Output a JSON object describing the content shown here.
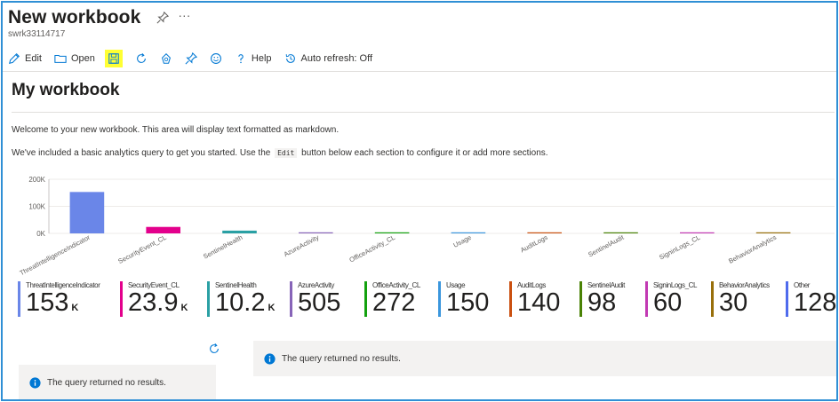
{
  "header": {
    "title": "New workbook",
    "more_label": "···",
    "subtitle": "swrk33114717"
  },
  "toolbar": {
    "edit_label": "Edit",
    "open_label": "Open",
    "help_label": "Help",
    "auto_refresh_label": "Auto refresh: Off"
  },
  "workbook": {
    "heading": "My workbook",
    "para1": "Welcome to your new workbook. This area will display text formatted as markdown.",
    "para2_before": "We've included a basic analytics query to get you started. Use the",
    "para2_code": "Edit",
    "para2_after": "button below each section to configure it or add more sections."
  },
  "colors": {
    "accent": "#2f8fd5",
    "highlight": "#ffff33",
    "info_icon": "#0078d4"
  },
  "chart_data": {
    "type": "bar",
    "ylim": [
      0,
      200000
    ],
    "yticks": [
      "200K",
      "100K",
      "0K"
    ],
    "ytick_values": [
      200000,
      100000,
      0
    ],
    "categories": [
      "ThreatIntelligenceIndicator",
      "SecurityEvent_CL",
      "SentinelHealth",
      "AzureActivity",
      "OfficeActivity_CL",
      "Usage",
      "AuditLogs",
      "SentinelAudit",
      "SigninLogs_CL",
      "BehaviorAnalytics"
    ],
    "values": [
      153000,
      23900,
      10200,
      505,
      272,
      150,
      140,
      98,
      60,
      30
    ],
    "colors": [
      "#6a86e8",
      "#e3008c",
      "#2aa0a4",
      "#8764b8",
      "#13a10e",
      "#3a96dd",
      "#ca5010",
      "#498205",
      "#c239b3",
      "#986f0b"
    ]
  },
  "tiles": [
    {
      "label": "ThreatIntelligenceIndicator",
      "value": "153",
      "unit": "K",
      "color": "#6a86e8"
    },
    {
      "label": "SecurityEvent_CL",
      "value": "23.9",
      "unit": "K",
      "color": "#e3008c"
    },
    {
      "label": "SentinelHealth",
      "value": "10.2",
      "unit": "K",
      "color": "#2aa0a4"
    },
    {
      "label": "AzureActivity",
      "value": "505",
      "unit": "",
      "color": "#8764b8"
    },
    {
      "label": "OfficeActivity_CL",
      "value": "272",
      "unit": "",
      "color": "#13a10e"
    },
    {
      "label": "Usage",
      "value": "150",
      "unit": "",
      "color": "#3a96dd"
    },
    {
      "label": "AuditLogs",
      "value": "140",
      "unit": "",
      "color": "#ca5010"
    },
    {
      "label": "SentinelAudit",
      "value": "98",
      "unit": "",
      "color": "#498205"
    },
    {
      "label": "SigninLogs_CL",
      "value": "60",
      "unit": "",
      "color": "#c239b3"
    },
    {
      "label": "BehaviorAnalytics",
      "value": "30",
      "unit": "",
      "color": "#986f0b"
    },
    {
      "label": "Other",
      "value": "128",
      "unit": "",
      "color": "#4f6bed"
    }
  ],
  "messages": {
    "left": "The query returned no results.",
    "right": "The query returned no results."
  }
}
